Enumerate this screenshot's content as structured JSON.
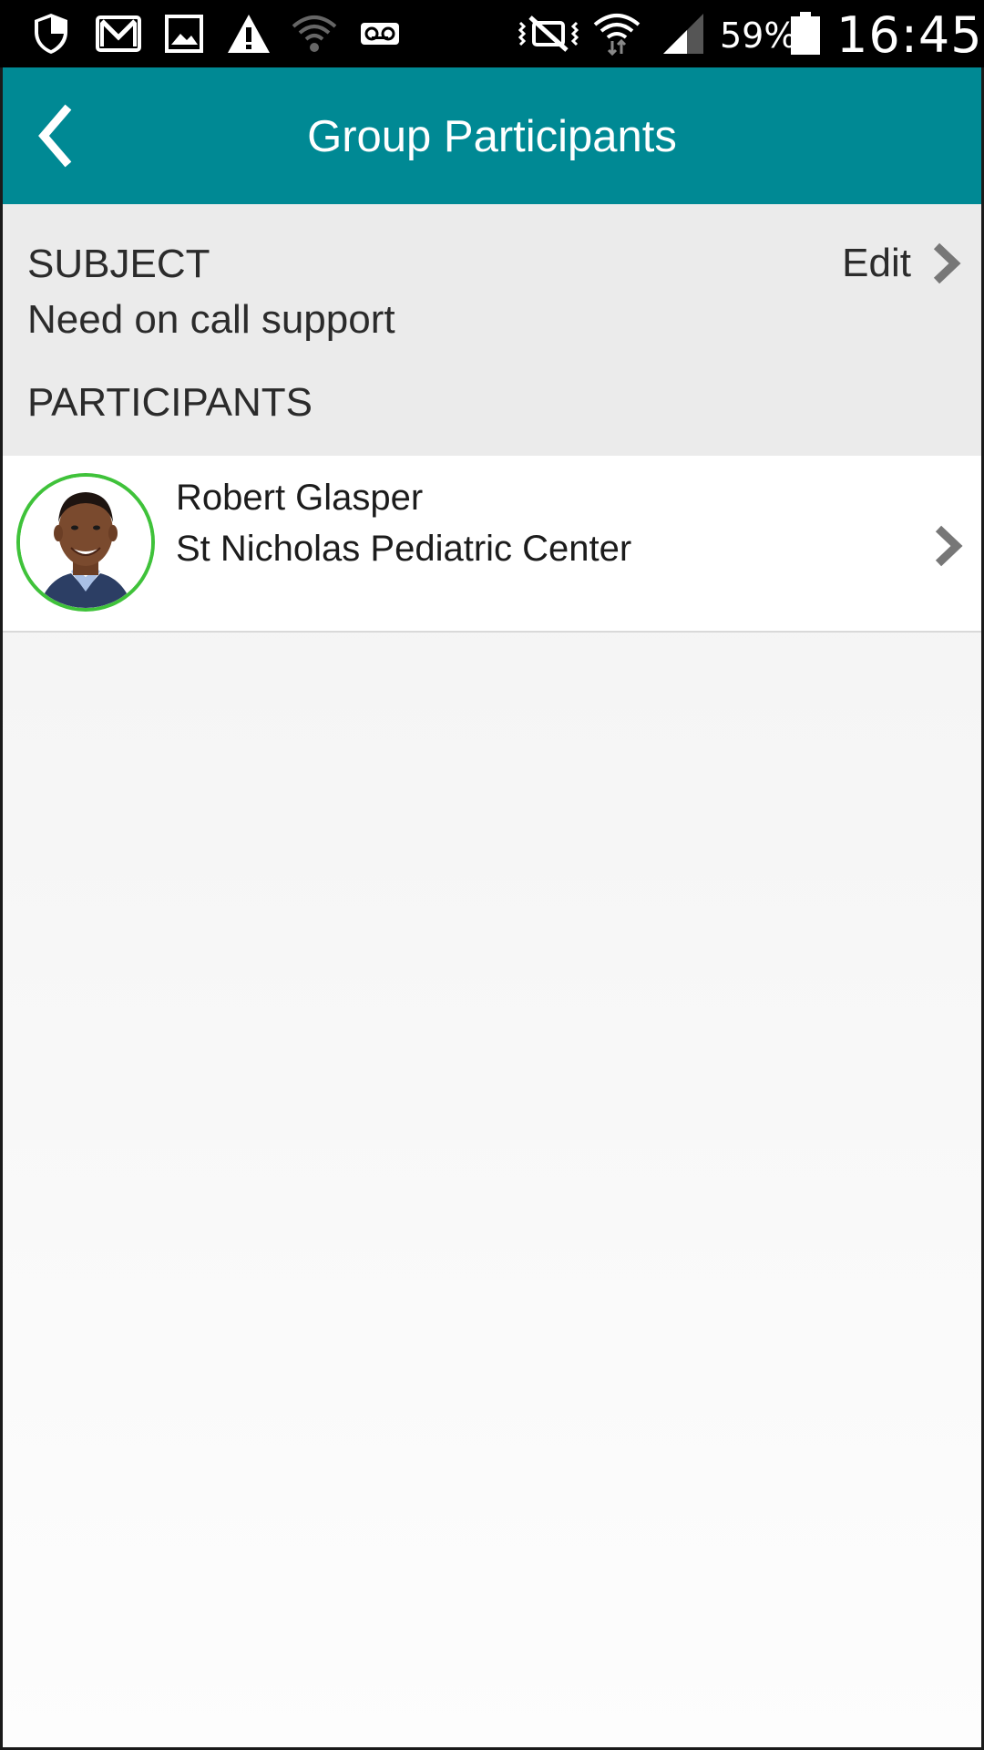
{
  "status_bar": {
    "left_icons": [
      "shield-icon",
      "gmail-icon",
      "gallery-icon",
      "warning-icon",
      "wifi-icon",
      "voicemail-icon"
    ],
    "right_icons": [
      "vibrate-mute-icon",
      "wifi-data-icon",
      "cell-signal-icon",
      "battery-icon"
    ],
    "battery_percent": "59%",
    "time": "16:45"
  },
  "app_bar": {
    "title": "Group Participants",
    "back_icon": "chevron-left-icon",
    "color": "#008994"
  },
  "subject": {
    "label": "SUBJECT",
    "value": "Need on call support",
    "edit_label": "Edit",
    "edit_icon": "chevron-right-icon"
  },
  "participants": {
    "label": "PARTICIPANTS",
    "items": [
      {
        "name": "Robert Glasper",
        "organization": "St Nicholas Pediatric Center",
        "status_color": "#3fc23a",
        "icon": "chevron-right-icon"
      }
    ]
  }
}
